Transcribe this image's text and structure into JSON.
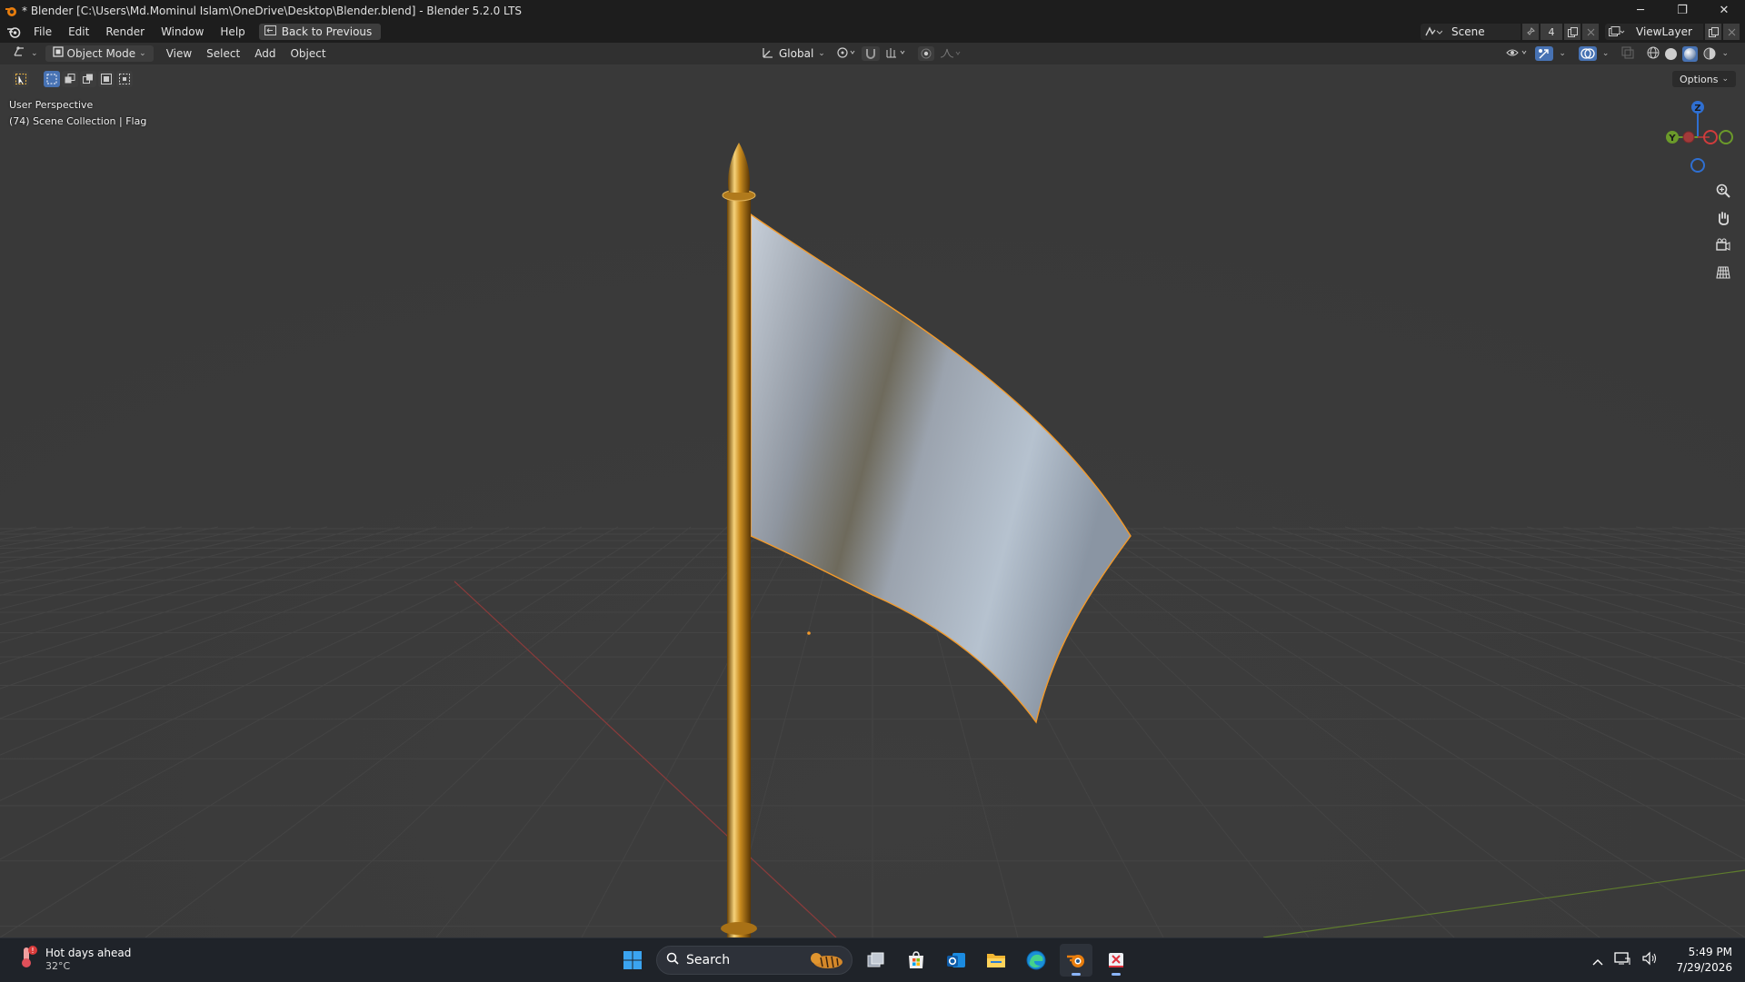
{
  "window": {
    "title": "* Blender [C:\\Users\\Md.Mominul Islam\\OneDrive\\Desktop\\Blender.blend] - Blender 5.2.0 LTS",
    "minimize": "─",
    "maximize": "❐",
    "close": "✕"
  },
  "menu": {
    "items": [
      "File",
      "Edit",
      "Render",
      "Window",
      "Help"
    ],
    "back_button": "Back to Previous",
    "scene": "Scene",
    "scene_users": "4",
    "view_layer": "ViewLayer"
  },
  "viewport_header": {
    "mode": "Object Mode",
    "menus": [
      "View",
      "Select",
      "Add",
      "Object"
    ],
    "orientation": "Global",
    "options": "Options"
  },
  "viewport": {
    "perspective": "User Perspective",
    "collection": "(74) Scene Collection | Flag",
    "gizmo_axes": {
      "z": "Z",
      "y": "Y"
    },
    "colors": {
      "selection_outline": "#f39a2a",
      "x_axis": "#a23a3a",
      "y_axis": "#6b9a2a",
      "z_axis": "#2f6fd1"
    }
  },
  "taskbar": {
    "weather_title": "Hot days ahead",
    "weather_temp": "32°C",
    "search_placeholder": "Search",
    "time": "5:49 PM",
    "date": "7/29/2026"
  }
}
